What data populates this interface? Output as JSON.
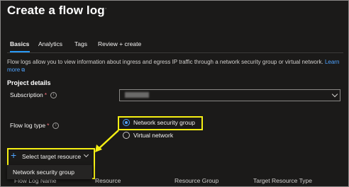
{
  "header": {
    "title": "Create a flow log",
    "more_icon": "ellipsis-icon"
  },
  "tabs": [
    {
      "label": "Basics",
      "active": true
    },
    {
      "label": "Analytics",
      "active": false
    },
    {
      "label": "Tags",
      "active": false
    },
    {
      "label": "Review + create",
      "active": false
    }
  ],
  "intro": {
    "text": "Flow logs allow you to view information about ingress and egress IP traffic through a network security group or virtual network.",
    "learn_more": "Learn more"
  },
  "project_details": {
    "title": "Project details",
    "subscription_label": "Subscription",
    "subscription_value": "redacted"
  },
  "flow_log_type": {
    "label": "Flow log type",
    "options": [
      {
        "label": "Network security group",
        "selected": true
      },
      {
        "label": "Virtual network",
        "selected": false
      }
    ]
  },
  "target": {
    "select_label": "Select target resource",
    "menu_items": [
      "Network security group"
    ]
  },
  "table": {
    "columns": [
      "Flow Log Name",
      "Resource",
      "Resource Group",
      "Target Resource Type"
    ]
  },
  "colors": {
    "background": "#1b1a19",
    "accent": "#4ea3ff",
    "highlight": "#f5ef13",
    "required": "#f1707b"
  }
}
